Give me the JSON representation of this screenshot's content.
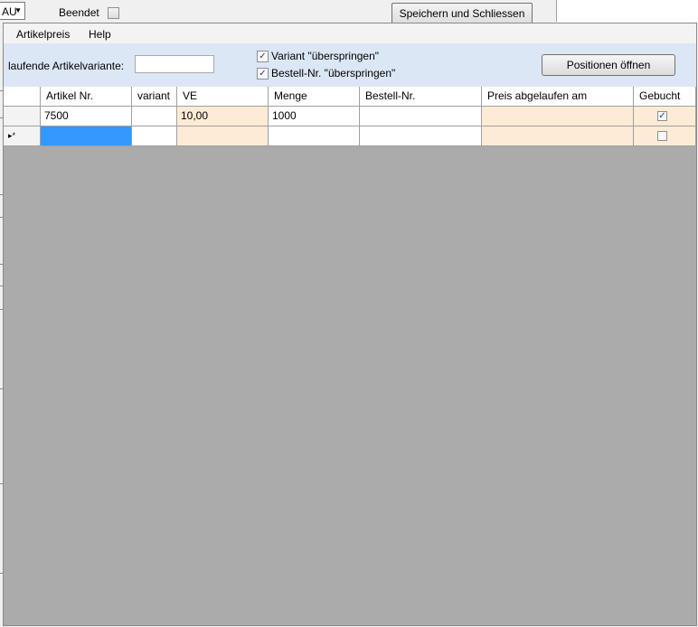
{
  "top": {
    "combo_value": "AU",
    "beendet_label": "Beendet",
    "beendet_checked": false,
    "save_button": "Speichern und Schliessen"
  },
  "menu": [
    "Artikelpreis",
    "Help"
  ],
  "panel": {
    "laufende_label": "laufende Artikelvariante:",
    "laufende_value": "",
    "variant_skip_label": "Variant \"überspringen\"",
    "variant_skip_checked": true,
    "bestell_skip_label": "Bestell-Nr. \"überspringen\"",
    "bestell_skip_checked": true,
    "open_positions_button": "Positionen öffnen"
  },
  "grid": {
    "columns": [
      "Artikel Nr.",
      "variant",
      "VE",
      "Menge",
      "Bestell-Nr.",
      "Preis abgelaufen am",
      "Gebucht"
    ],
    "rows": [
      {
        "marker": "",
        "artikel_nr": "7500",
        "variant": "",
        "ve": "10,00",
        "menge": "1000",
        "bestell_nr": "",
        "preis_abgelaufen": "",
        "gebucht": true
      },
      {
        "marker": "▸*",
        "artikel_nr": "",
        "variant": "",
        "ve": "",
        "menge": "",
        "bestell_nr": "",
        "preis_abgelaufen": "",
        "gebucht": false
      }
    ]
  },
  "colors": {
    "panel_bg": "#dce7f5",
    "peach": "#fdebd6",
    "selection": "#3399ff",
    "grid_empty_area": "#ababab"
  }
}
